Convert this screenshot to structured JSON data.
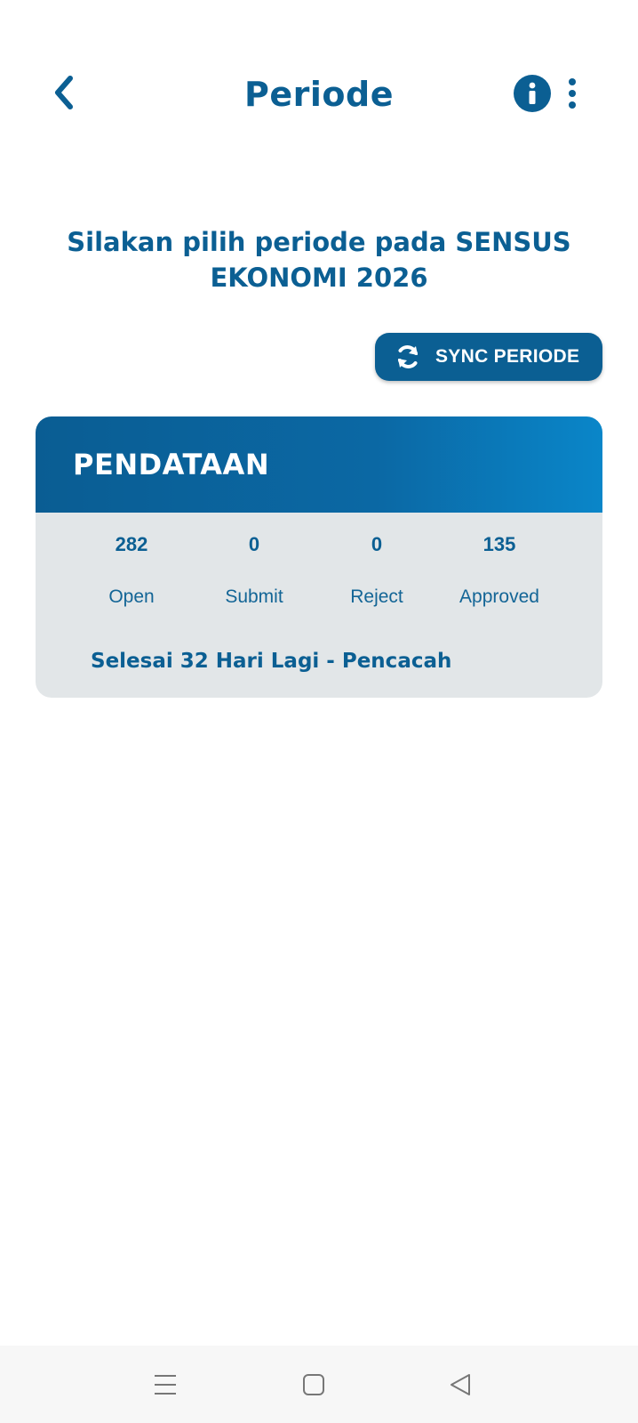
{
  "header": {
    "title": "Periode",
    "back_icon": "chevron-left-icon",
    "info_icon": "info-icon",
    "more_icon": "more-vertical-icon"
  },
  "heading": {
    "line1": "Silakan pilih periode pada SENSUS",
    "line2": "EKONOMI 2026"
  },
  "sync_button": {
    "label": "SYNC PERIODE",
    "icon": "sync-icon"
  },
  "card": {
    "title": "PENDATAAN",
    "stats": [
      {
        "value": "282",
        "label": "Open"
      },
      {
        "value": "0",
        "label": "Submit"
      },
      {
        "value": "0",
        "label": "Reject"
      },
      {
        "value": "135",
        "label": "Approved"
      }
    ],
    "footer": "Selesai 32 Hari Lagi - Pencacah"
  },
  "colors": {
    "primary": "#0b5f93",
    "card_background": "#e2e6e8",
    "gradient_end": "#0a86c9"
  },
  "nav_bar": {
    "items": [
      "menu-icon",
      "home-square-icon",
      "back-triangle-icon"
    ]
  }
}
